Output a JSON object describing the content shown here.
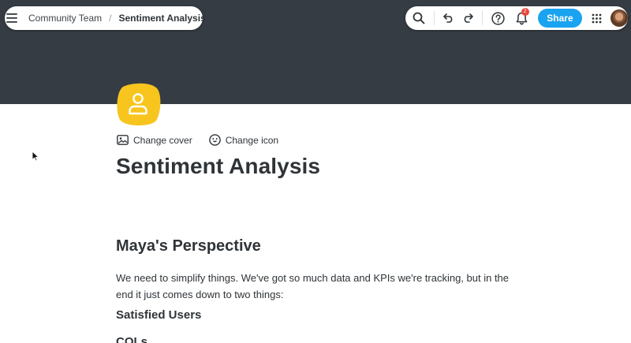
{
  "breadcrumb": {
    "team": "Community Team",
    "separator": "/",
    "current": "Sentiment Analysis"
  },
  "toolbar": {
    "notification_count": "2",
    "share_label": "Share"
  },
  "icons": {
    "menu": "hamburger-menu-icon",
    "search": "search-icon",
    "undo": "undo-icon",
    "redo": "redo-icon",
    "help": "help-circle-icon",
    "notifications": "bell-icon",
    "apps": "apps-grid-icon",
    "page": "user-icon"
  },
  "cover_actions": {
    "change_cover": "Change cover",
    "change_icon": "Change icon"
  },
  "page": {
    "title": "Sentiment Analysis"
  },
  "content": {
    "heading": "Maya's Perspective",
    "paragraph": "We need to simplify things. We've got so much data and KPIs we're tracking, but in the end it just comes down to two things:",
    "subheading_1": "Satisfied Users",
    "subheading_2": "COLs"
  },
  "colors": {
    "cover": "#363c43",
    "accent": "#1aa3f0",
    "page_icon": "#f7c51e",
    "badge": "#e8453c"
  }
}
